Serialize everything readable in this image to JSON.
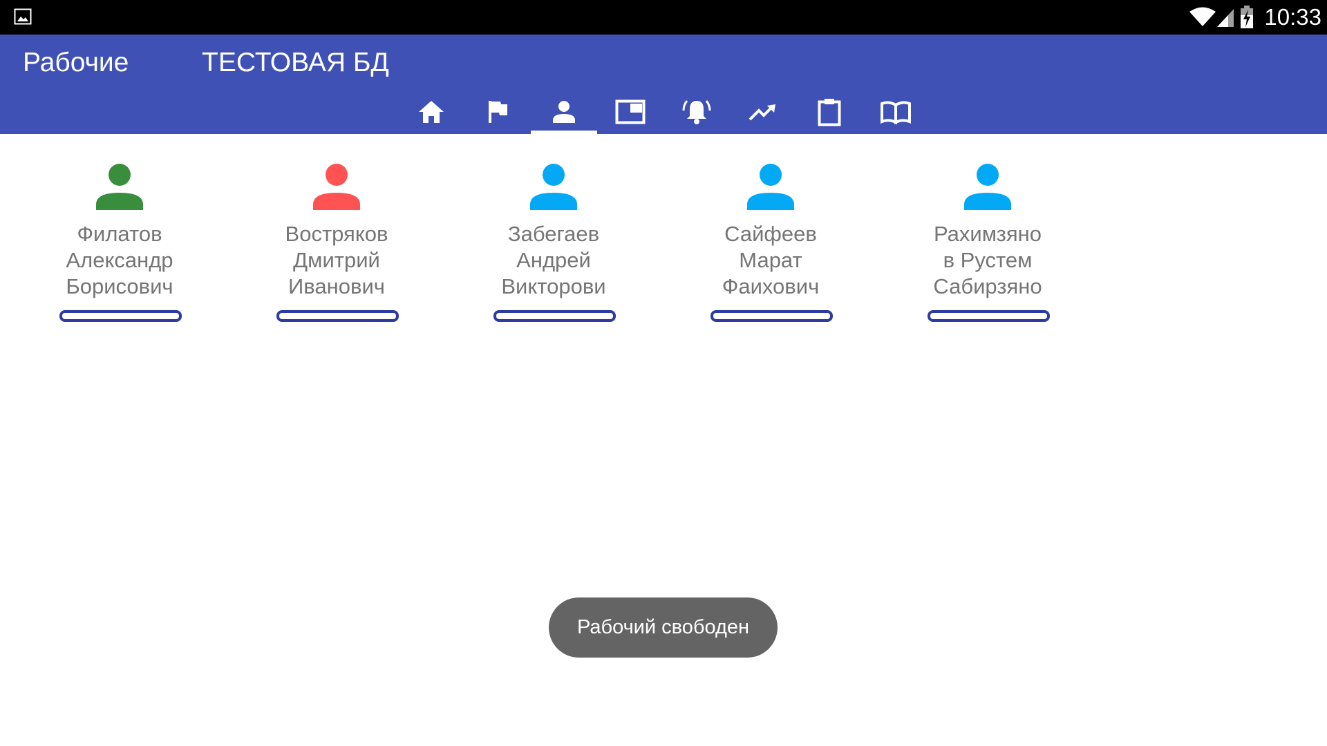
{
  "status_bar": {
    "time": "10:33",
    "icons": [
      "image-notification-icon",
      "wifi-icon",
      "cell-signal-icon",
      "battery-charging-icon"
    ]
  },
  "app_bar": {
    "title": "Рабочие",
    "database_name": "ТЕСТОВАЯ БД",
    "background_color": "#3f51b5",
    "tabs": [
      {
        "icon": "home-icon",
        "selected": false
      },
      {
        "icon": "flag-icon",
        "selected": false
      },
      {
        "icon": "person-icon",
        "selected": true
      },
      {
        "icon": "window-icon",
        "selected": false
      },
      {
        "icon": "alarm-bell-icon",
        "selected": false
      },
      {
        "icon": "trending-up-icon",
        "selected": false
      },
      {
        "icon": "clipboard-icon",
        "selected": false
      },
      {
        "icon": "book-icon",
        "selected": false
      }
    ]
  },
  "workers": [
    {
      "name": "Филатов Александр Борисович",
      "line1": "Филатов",
      "line2": "Александр",
      "line3": "Борисович",
      "status_color": "#388e3c"
    },
    {
      "name": "Востряков Дмитрий Иванович",
      "line1": "Востряков",
      "line2": "Дмитрий",
      "line3": "Иванович",
      "status_color": "#ff5252"
    },
    {
      "name": "Забегаев Андрей Викторови",
      "line1": "Забегаев",
      "line2": "Андрей",
      "line3": "Викторови",
      "status_color": "#03a9f4"
    },
    {
      "name": "Сайфеев Марат Фаихович",
      "line1": "Сайфеев",
      "line2": "Марат",
      "line3": "Фаихович",
      "status_color": "#03a9f4"
    },
    {
      "name": "Рахимзяно в Рустем Сабирзяно",
      "line1": "Рахимзяно",
      "line2": "в Рустем",
      "line3": "Сабирзяно",
      "status_color": "#03a9f4"
    }
  ],
  "toast": {
    "message": "Рабочий свободен"
  },
  "colors": {
    "primary": "#3f51b5",
    "bar_border": "#2c3ca0",
    "name_text": "#757575",
    "toast_background": "#646464"
  }
}
